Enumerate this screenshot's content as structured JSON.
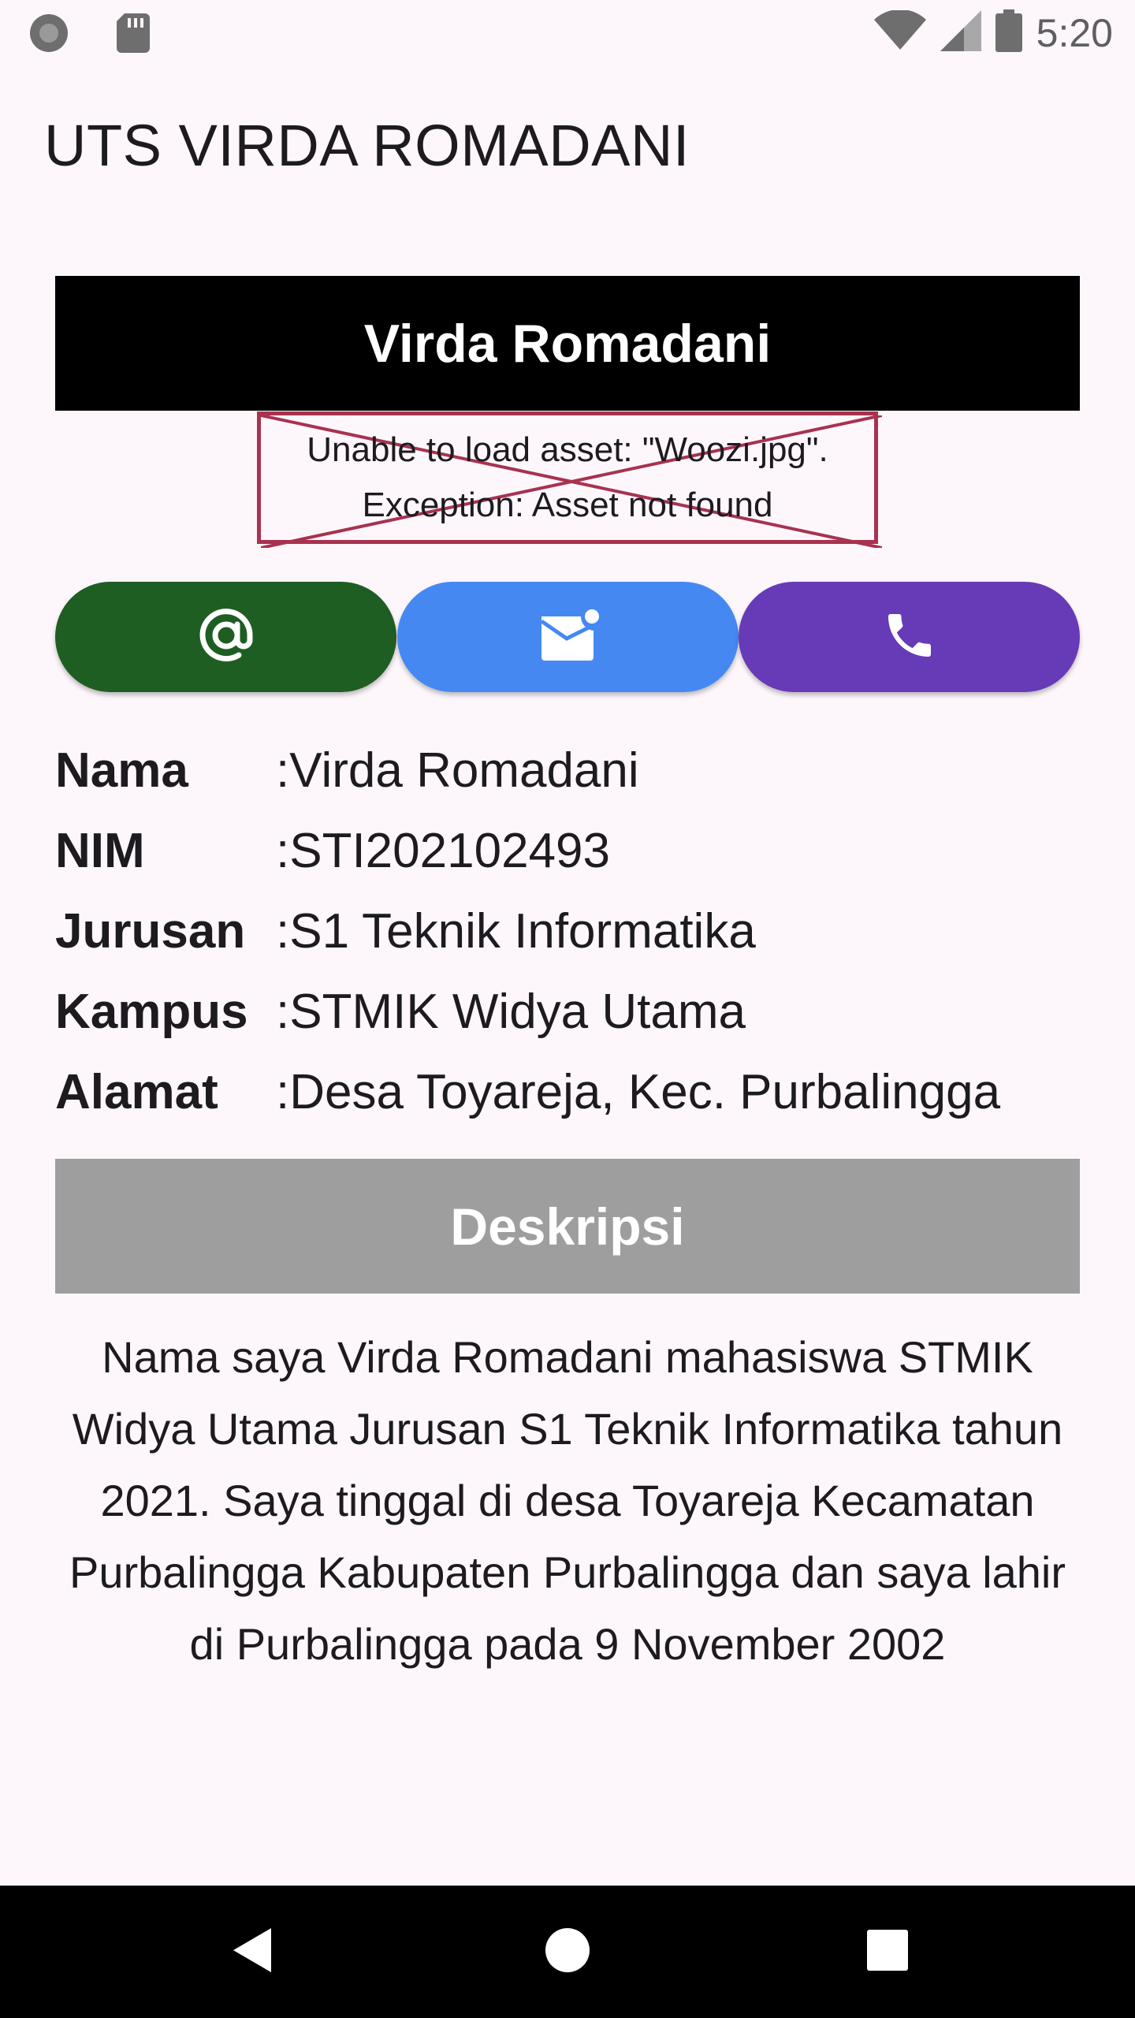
{
  "status_bar": {
    "time": "5:20",
    "icons": [
      "record-icon",
      "sd-card-icon",
      "wifi-icon",
      "signal-icon",
      "battery-icon"
    ]
  },
  "app_bar": {
    "title": "UTS VIRDA ROMADANI"
  },
  "profile": {
    "name_banner": "Virda Romadani",
    "image_error_line1": "Unable to load asset: \"Woozi.jpg\".",
    "image_error_line2": "Exception: Asset not found"
  },
  "actions": [
    {
      "icon": "at-sign-icon",
      "color": "#1f5e22"
    },
    {
      "icon": "mail-icon",
      "color": "#4588f2"
    },
    {
      "icon": "phone-icon",
      "color": "#673ab7"
    }
  ],
  "info": {
    "rows": [
      {
        "label": "Nama",
        "value": ":Virda Romadani"
      },
      {
        "label": "NIM",
        "value": ":STI202102493"
      },
      {
        "label": "Jurusan",
        "value": ":S1 Teknik Informatika"
      },
      {
        "label": "Kampus",
        "value": ":STMIK Widya Utama"
      },
      {
        "label": "Alamat",
        "value": ":Desa Toyareja, Kec. Purbalingga"
      }
    ]
  },
  "description": {
    "title": "Deskripsi",
    "text": "Nama saya Virda Romadani mahasiswa STMIK Widya Utama Jurusan S1 Teknik Informatika tahun 2021. Saya tinggal di desa Toyareja Kecamatan Purbalingga Kabupaten Purbalingga dan saya lahir di Purbalingga pada 9 November 2002"
  },
  "nav_bar": {
    "icons": [
      "back-icon",
      "home-icon",
      "recents-icon"
    ]
  }
}
